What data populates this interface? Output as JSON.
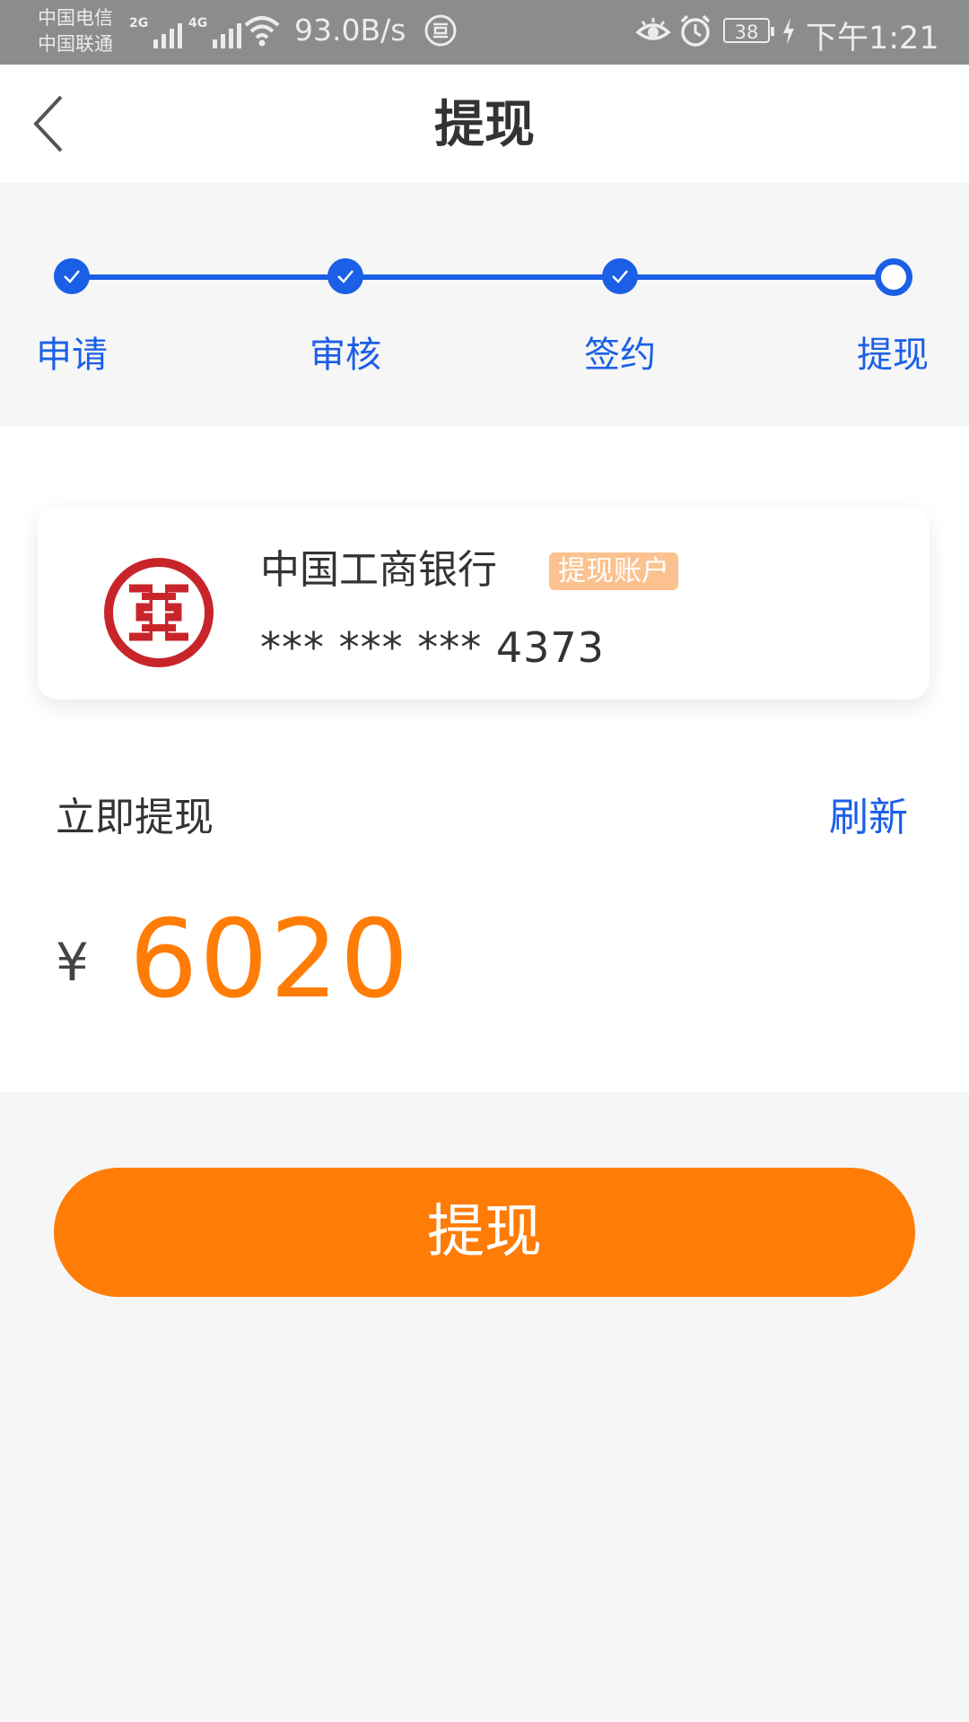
{
  "status_bar": {
    "carrier_1": "中国电信",
    "carrier_2": "中国联通",
    "net_1": "2G",
    "net_2": "4G",
    "speed": "93.0B/s",
    "battery": "38",
    "time": "下午1:21"
  },
  "header": {
    "title": "提现"
  },
  "steps": [
    {
      "label": "申请",
      "state": "done"
    },
    {
      "label": "审核",
      "state": "done"
    },
    {
      "label": "签约",
      "state": "done"
    },
    {
      "label": "提现",
      "state": "current"
    }
  ],
  "bank_card": {
    "bank_name": "中国工商银行",
    "badge": "提现账户",
    "card_number": "*** *** *** 4373"
  },
  "withdraw": {
    "label": "立即提现",
    "refresh": "刷新",
    "currency": "¥",
    "amount": "6020"
  },
  "button": {
    "label": "提现"
  },
  "colors": {
    "accent_blue": "#1b5fe6",
    "accent_orange": "#ff7c06",
    "badge": "#fbc28f"
  }
}
